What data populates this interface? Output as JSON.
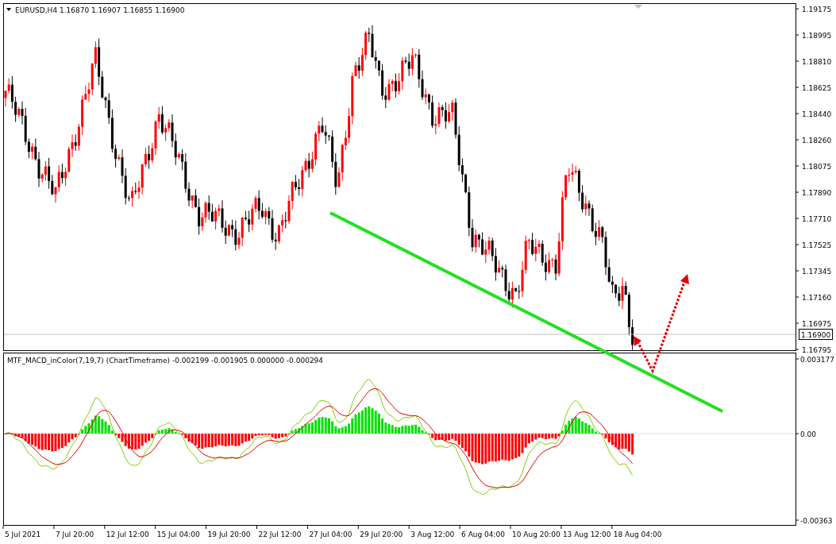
{
  "chart_header": "EURUSD,H4  1.16870 1.16907 1.16855 1.16900",
  "price_axis": [
    "1.19175",
    "1.18995",
    "1.18810",
    "1.18625",
    "1.18440",
    "1.18260",
    "1.18075",
    "1.17890",
    "1.17710",
    "1.17525",
    "1.17345",
    "1.17160",
    "1.16975",
    "1.16795"
  ],
  "current_price": "1.16900",
  "indicator_header": "MTF_MACD_inColor(7,19,7) (ChartTimeframe) -0.002199 -0.001905 0.000000 -0.000294",
  "indicator_axis": [
    "0.003177",
    "0.00",
    "-0.00363"
  ],
  "time_axis": [
    "5 Jul 2021",
    "7 Jul 20:00",
    "12 Jul 12:00",
    "15 Jul 04:00",
    "19 Jul 20:00",
    "22 Jul 12:00",
    "27 Jul 04:00",
    "29 Jul 20:00",
    "3 Aug 12:00",
    "6 Aug 04:00",
    "10 Aug 20:00",
    "13 Aug 12:00",
    "18 Aug 04:00"
  ]
}
